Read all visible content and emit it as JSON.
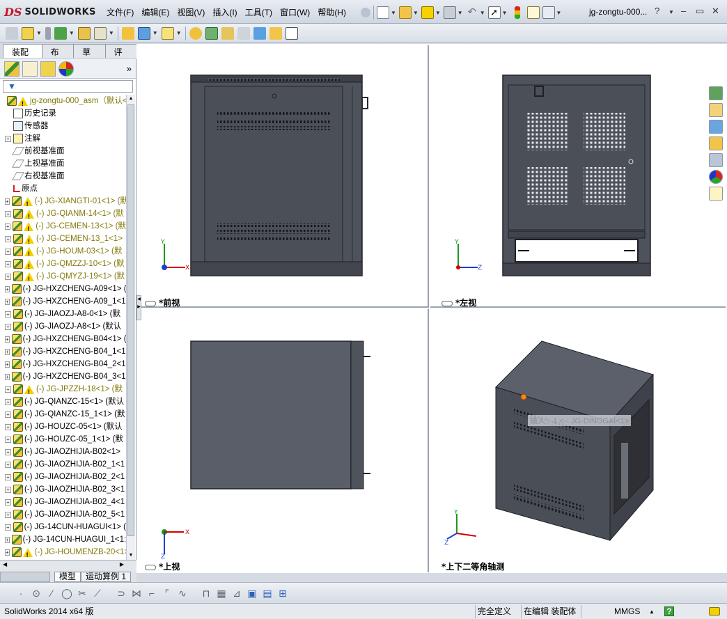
{
  "app": {
    "logo_ds": "DS",
    "logo_name": "SOLIDWORKS",
    "document_title": "jg-zongtu-000...",
    "help_symbol": "?"
  },
  "menu": [
    "文件(F)",
    "编辑(E)",
    "视图(V)",
    "插入(I)",
    "工具(T)",
    "窗口(W)",
    "帮助(H)"
  ],
  "command_tabs": [
    "装配体",
    "布局",
    "草图",
    "评估"
  ],
  "tree": {
    "root": "jg-zongtu-000_asm（默认<…",
    "fixed": [
      "历史记录",
      "传感器",
      "注解",
      "前视基准面",
      "上视基准面",
      "右视基准面",
      "原点"
    ],
    "components": [
      {
        "label": "(-) JG-XIANGTI-01<1> (默",
        "warn": true
      },
      {
        "label": "(-) JG-QIANM-14<1> (默",
        "warn": true
      },
      {
        "label": "(-) JG-CEMEN-13<1> (默",
        "warn": true
      },
      {
        "label": "(-) JG-CEMEN-13_1<1>",
        "warn": true
      },
      {
        "label": "(-) JG-HOUM-03<1> (默",
        "warn": true
      },
      {
        "label": "(-) JG-QMZZJ-10<1> (默",
        "warn": true
      },
      {
        "label": "(-) JG-QMYZJ-19<1> (默",
        "warn": true
      },
      {
        "label": "(-) JG-HXZCHENG-A09<1> (",
        "warn": false
      },
      {
        "label": "(-) JG-HXZCHENG-A09_1<1:",
        "warn": false
      },
      {
        "label": "(-) JG-JIAOZJ-A8-0<1> (默",
        "warn": false
      },
      {
        "label": "(-) JG-JIAOZJ-A8<1> (默认",
        "warn": false
      },
      {
        "label": "(-) JG-HXZCHENG-B04<1> (",
        "warn": false
      },
      {
        "label": "(-) JG-HXZCHENG-B04_1<1:",
        "warn": false
      },
      {
        "label": "(-) JG-HXZCHENG-B04_2<1:",
        "warn": false
      },
      {
        "label": "(-) JG-HXZCHENG-B04_3<1:",
        "warn": false
      },
      {
        "label": "(-) JG-JPZZH-18<1> (默",
        "warn": true
      },
      {
        "label": "(-) JG-QIANZC-15<1> (默认",
        "warn": false
      },
      {
        "label": "(-) JG-QIANZC-15_1<1> (默",
        "warn": false
      },
      {
        "label": "(-) JG-HOUZC-05<1> (默认",
        "warn": false
      },
      {
        "label": "(-) JG-HOUZC-05_1<1> (默",
        "warn": false
      },
      {
        "label": "(-) JG-JIAOZHIJIA-B02<1>",
        "warn": false
      },
      {
        "label": "(-) JG-JIAOZHIJIA-B02_1<1",
        "warn": false
      },
      {
        "label": "(-) JG-JIAOZHIJIA-B02_2<1",
        "warn": false
      },
      {
        "label": "(-) JG-JIAOZHIJIA-B02_3<1",
        "warn": false
      },
      {
        "label": "(-) JG-JIAOZHIJIA-B02_4<1",
        "warn": false
      },
      {
        "label": "(-) JG-JIAOZHIJIA-B02_5<1",
        "warn": false
      },
      {
        "label": "(-) JG-14CUN-HUAGUI<1> (",
        "warn": false
      },
      {
        "label": "(-) JG-14CUN-HUAGUI_1<1:",
        "warn": false
      },
      {
        "label": "(-) JG-HOUMENZB-20<1> (",
        "warn": true
      }
    ]
  },
  "model_tabs": [
    "模型",
    "运动算例 1"
  ],
  "viewports": {
    "front": "*前视",
    "left": "*左视",
    "top": "*上视",
    "iso": "*上下二等角轴测"
  },
  "axis_labels": {
    "x": "X",
    "y": "Y",
    "z": "Z"
  },
  "tooltip": "输入：1 <-- JG-DINGGAI<1>",
  "status": {
    "version": "SolidWorks 2014 x64 版",
    "definition": "完全定义",
    "mode": "在编辑 装配体",
    "units": "MMGS",
    "help": "?"
  },
  "colors": {
    "cabinet_dark": "#4a4e57",
    "cabinet_edge": "#2a2d33",
    "accent_red": "#c0162a",
    "axis_x": "#d40000",
    "axis_y": "#1a9a1a",
    "axis_z": "#1f3fd0"
  }
}
